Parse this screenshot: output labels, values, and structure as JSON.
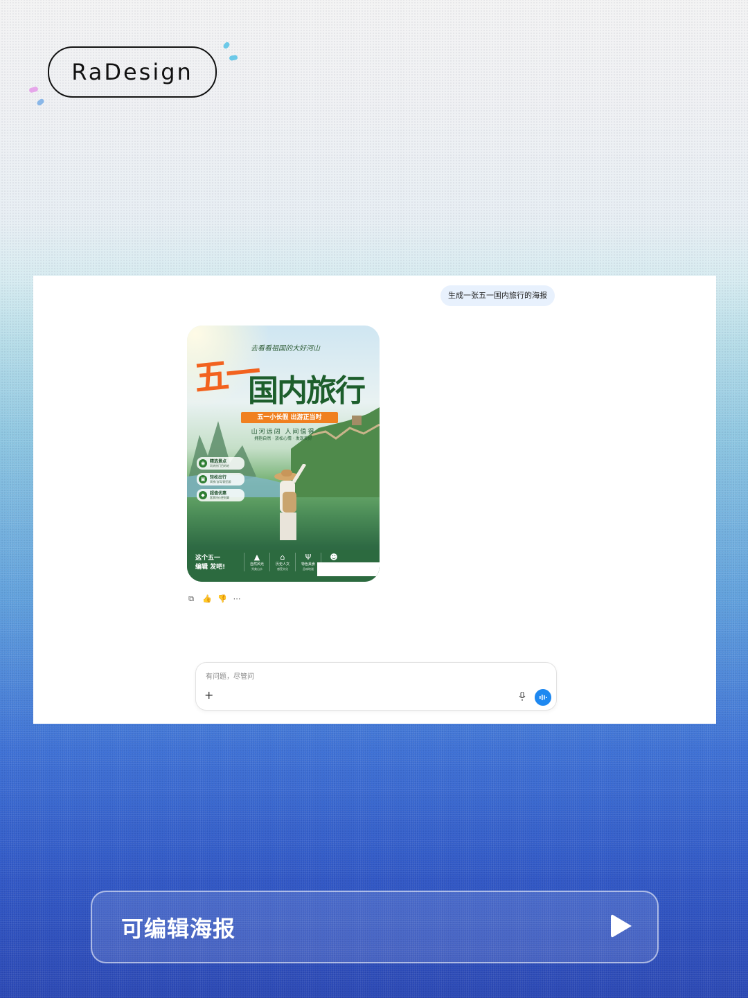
{
  "brand": {
    "name": "RaDesign"
  },
  "chat": {
    "user_message": "生成一张五一国内旅行的海报",
    "input_placeholder": "有问题，尽管问",
    "plus_label": "+"
  },
  "poster": {
    "tagline": "去看看祖国的大好河山",
    "title_1": "五一",
    "title_2": "国内旅行",
    "banner": "五一小长假  出游正当时",
    "sub_1": "山河远阔 人间值得",
    "sub_2": "拥抱自然 · 放松心情 · 发现美好",
    "features": [
      {
        "title": "精选景点",
        "desc": "玩转热门目的地",
        "icon": "camera-icon"
      },
      {
        "title": "轻松出行",
        "desc": "高铁/自驾/跟团游",
        "icon": "luggage-icon"
      },
      {
        "title": "超值优惠",
        "desc": "套票特价更划算",
        "icon": "tag-icon"
      }
    ],
    "slogan_1": "这个五一",
    "slogan_2": "编辑",
    "slogan_3": "发吧!",
    "categories": [
      {
        "label": "自然风光",
        "sub": "秀美山水",
        "icon": "mountain-icon"
      },
      {
        "label": "历史人文",
        "sub": "感受文化",
        "icon": "temple-icon"
      },
      {
        "label": "特色美食",
        "sub": "品味地道",
        "icon": "fork-icon"
      },
      {
        "label": "",
        "sub": "",
        "icon": "people-icon"
      }
    ]
  },
  "cta": {
    "label": "可编辑海报"
  },
  "colors": {
    "accent": "#1e88f0",
    "poster_green": "#2c6a3f",
    "poster_orange": "#f08020"
  }
}
